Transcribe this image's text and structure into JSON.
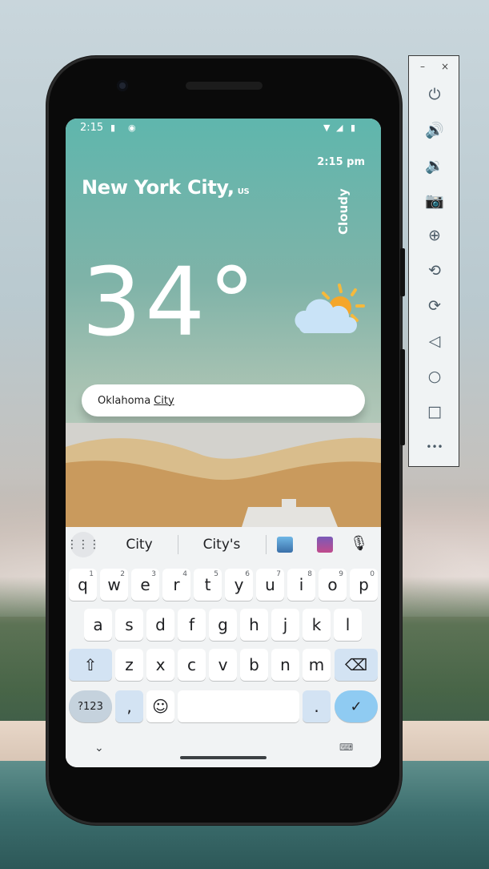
{
  "phone": {
    "status_time": "2:15",
    "app": {
      "time": "2:15 pm",
      "city": "New York City,",
      "country": "US",
      "condition": "Cloudy",
      "temperature": "34°",
      "search_value": "Oklahoma",
      "search_value_underlined": "City"
    },
    "keyboard": {
      "suggestions": [
        "City",
        "City's"
      ],
      "rows": [
        [
          "q",
          "w",
          "e",
          "r",
          "t",
          "y",
          "u",
          "i",
          "o",
          "p"
        ],
        [
          "a",
          "s",
          "d",
          "f",
          "g",
          "h",
          "j",
          "k",
          "l"
        ],
        [
          "z",
          "x",
          "c",
          "v",
          "b",
          "n",
          "m"
        ]
      ],
      "digits": [
        "1",
        "2",
        "3",
        "4",
        "5",
        "6",
        "7",
        "8",
        "9",
        "0"
      ],
      "symbols_key": "?123",
      "comma_key": ",",
      "period_key": "."
    }
  },
  "emulator_toolbar": {
    "minimize": "–",
    "close": "×",
    "buttons": [
      {
        "name": "power-icon",
        "glyph": "⏻"
      },
      {
        "name": "volume-up-icon",
        "glyph": "🔊"
      },
      {
        "name": "volume-down-icon",
        "glyph": "🔉"
      },
      {
        "name": "camera-icon",
        "glyph": "📷"
      },
      {
        "name": "zoom-icon",
        "glyph": "⊕"
      },
      {
        "name": "rotate-left-icon",
        "glyph": "⟲"
      },
      {
        "name": "rotate-right-icon",
        "glyph": "⟳"
      },
      {
        "name": "back-icon",
        "glyph": "◁"
      },
      {
        "name": "home-icon",
        "glyph": "○"
      },
      {
        "name": "overview-icon",
        "glyph": "□"
      },
      {
        "name": "more-icon",
        "glyph": "•••"
      }
    ]
  }
}
